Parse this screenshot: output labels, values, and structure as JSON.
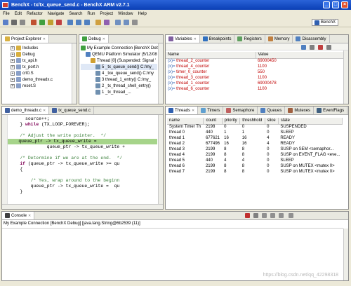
{
  "app": {
    "title": "BenchX - tx/tx_queue_send.c - BenchX ARM v2.7.1"
  },
  "menu": [
    "File",
    "Edit",
    "Refactor",
    "Navigate",
    "Search",
    "Run",
    "Project",
    "Window",
    "Help"
  ],
  "perspective": "BenchX",
  "project_explorer": {
    "tab": "Project Explorer",
    "items": [
      {
        "label": "Includes",
        "expand": "+",
        "depth": 0
      },
      {
        "label": "Debug",
        "expand": "+",
        "depth": 0
      },
      {
        "label": "tx_api.h",
        "expand": "+",
        "depth": 0
      },
      {
        "label": "tx_port.h",
        "expand": "+",
        "depth": 0
      },
      {
        "label": "crt0.S",
        "expand": "+",
        "depth": 0
      },
      {
        "label": "demo_threadx.c",
        "expand": "+",
        "depth": 0
      },
      {
        "label": "reset.S",
        "expand": "+",
        "depth": 0
      }
    ]
  },
  "debug": {
    "tab": "Debug",
    "items": [
      {
        "label": "My Example Connection [BenchX Debug] [C/C++",
        "depth": 0
      },
      {
        "label": "QEMU Platform Simulator (5/12/08 ...",
        "depth": 1
      },
      {
        "label": "Thread [0] (Suspended: Signal '",
        "depth": 2
      },
      {
        "label": "5 _tx_queue_send() C:/my_",
        "depth": 3,
        "selected": true
      },
      {
        "label": "4 _txe_queue_send() C:/my",
        "depth": 3
      },
      {
        "label": "3 thread_1_entry() C:/my_",
        "depth": 3
      },
      {
        "label": "2 _tx_thread_shell_entry()",
        "depth": 3
      },
      {
        "label": "1 _tx_thread_...",
        "depth": 3
      }
    ]
  },
  "variables": {
    "tabs": [
      "Variables",
      "Breakpoints",
      "Registers",
      "Memory",
      "Disassembly"
    ],
    "columns": [
      "Name",
      "Value"
    ],
    "rows": [
      {
        "name": "thread_2_counter",
        "value": "69000450"
      },
      {
        "name": "thread_4_counter",
        "value": "1100"
      },
      {
        "name": "timer_0_counter",
        "value": "550"
      },
      {
        "name": "thread_3_counter",
        "value": "1100"
      },
      {
        "name": "thread_1_counter",
        "value": "69000478"
      },
      {
        "name": "thread_6_counter",
        "value": "1100"
      }
    ]
  },
  "editor": {
    "tabs": [
      "demo_threadx.c",
      "tx_queue_send.c"
    ],
    "lines": [
      {
        "text": "      source++;",
        "type": "code"
      },
      {
        "text": "    } while (TX_LOOP_FOREVER);",
        "type": "code"
      },
      {
        "text": "",
        "type": "code"
      },
      {
        "text": "    /* Adjust the write pointer.  */",
        "type": "comment"
      },
      {
        "text": "    queue_ptr -> tx_queue_write =",
        "type": "highlight"
      },
      {
        "text": "              queue_ptr -> tx_queue_write +",
        "type": "code"
      },
      {
        "text": "",
        "type": "code"
      },
      {
        "text": "    /* Determine if we are at the end.  */",
        "type": "comment"
      },
      {
        "text": "    if (queue_ptr -> tx_queue_write >= qu",
        "type": "keyword"
      },
      {
        "text": "    {",
        "type": "code"
      },
      {
        "text": "",
        "type": "code"
      },
      {
        "text": "        /* Yes, wrap around to the beginn",
        "type": "comment"
      },
      {
        "text": "        queue_ptr -> tx_queue_write =  qu",
        "type": "code"
      },
      {
        "text": "    }",
        "type": "code"
      }
    ]
  },
  "threads": {
    "tabs": [
      "Threads",
      "Timers",
      "Semaphore",
      "Queues",
      "Mutexes",
      "EventFlags"
    ],
    "columns": [
      "name",
      "count",
      "priority",
      "threshhold",
      "slice",
      "state"
    ],
    "rows": [
      [
        "System Timer Th",
        "2198",
        "0",
        "0",
        "0",
        "SUSPENDED"
      ],
      [
        "thread 0",
        "440",
        "1",
        "1",
        "0",
        "SLEEP"
      ],
      [
        "thread 1",
        "677621",
        "16",
        "16",
        "4",
        "READY"
      ],
      [
        "thread 2",
        "677496",
        "16",
        "16",
        "4",
        "READY"
      ],
      [
        "thread 3",
        "2199",
        "8",
        "8",
        "0",
        "SUSP on SEM <semaphor..."
      ],
      [
        "thread 4",
        "2199",
        "8",
        "8",
        "0",
        "SUSP on EVENT_FLAG <eve..."
      ],
      [
        "thread 5",
        "440",
        "4",
        "4",
        "0",
        "SLEEP"
      ],
      [
        "thread 6",
        "2199",
        "8",
        "8",
        "0",
        "SUSP on MUTEX <mutex 0>"
      ],
      [
        "thread 7",
        "2199",
        "8",
        "8",
        "0",
        "SUSP on MUTEX <mutex 0>"
      ]
    ]
  },
  "console": {
    "tab": "Console",
    "line": "My Example Connection [BenchX Debug] [java.lang.String@6b2539 (11)]"
  },
  "watermark": "https://blog.csdn.net/qq_42298318"
}
